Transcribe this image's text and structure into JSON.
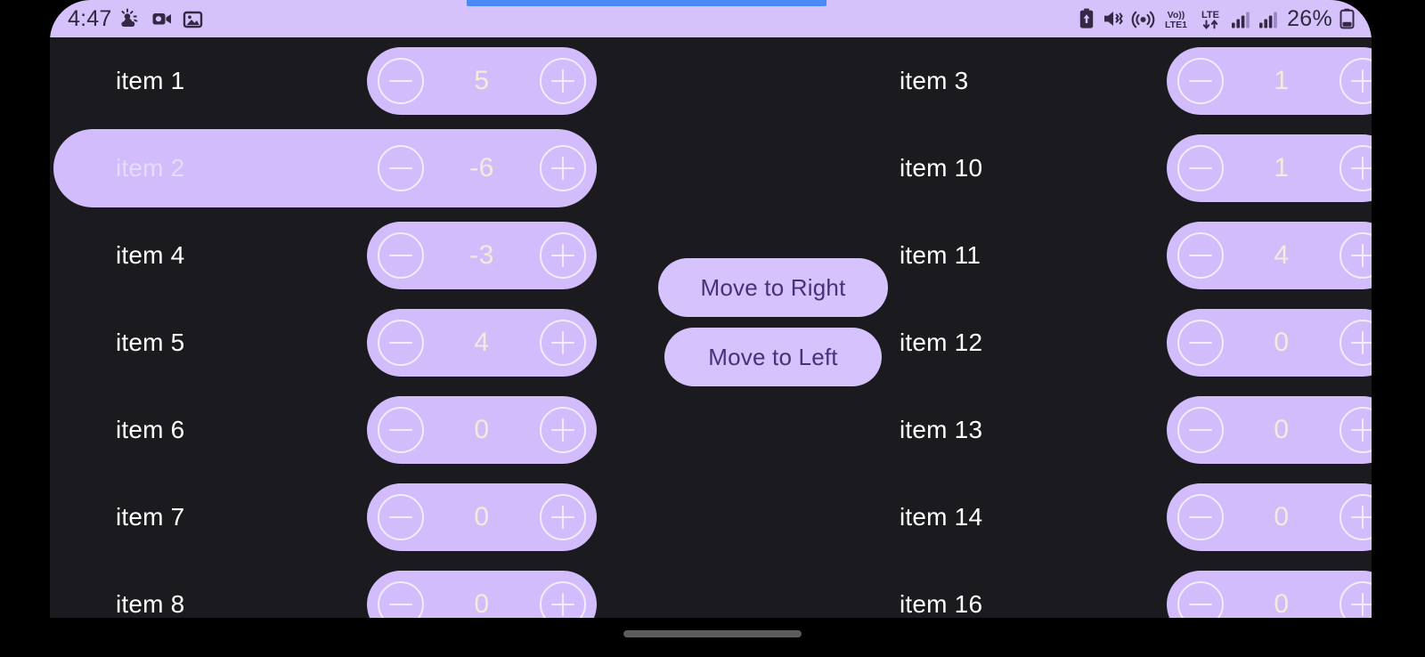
{
  "status_bar": {
    "clock": "4:47",
    "left_icons": [
      "weather-partly-cloudy-icon",
      "video-camera-icon",
      "image-gallery-icon"
    ],
    "right_icons": [
      "battery-saver-icon",
      "vibrate-mute-icon",
      "hotspot-icon",
      "volte-lte1-icon",
      "lte-data-icon",
      "signal-bars-sim1-icon",
      "signal-bars-sim2-icon"
    ],
    "battery_text": "26%",
    "battery_icon": "battery-icon",
    "background": "#d5c2fb"
  },
  "indicator": {
    "name": "top-progress-indicator",
    "color": "#4a8af4"
  },
  "theme": {
    "app_background": "#1b1b1f",
    "accent_purple": "#d2bcfb",
    "button_text": "#4a2f7a",
    "value_text": "#f2ecd8",
    "label_text": "#ffffff"
  },
  "stepper_icons": {
    "decrement": "minus-circle-icon",
    "increment": "plus-circle-icon"
  },
  "left_column": [
    {
      "label": "item 1",
      "value": "5",
      "selected": false
    },
    {
      "label": "item 2",
      "value": "-6",
      "selected": true
    },
    {
      "label": "item 4",
      "value": "-3",
      "selected": false
    },
    {
      "label": "item 5",
      "value": "4",
      "selected": false
    },
    {
      "label": "item 6",
      "value": "0",
      "selected": false
    },
    {
      "label": "item 7",
      "value": "0",
      "selected": false
    },
    {
      "label": "item 8",
      "value": "0",
      "selected": false
    }
  ],
  "right_column": [
    {
      "label": "item 3",
      "value": "1",
      "selected": false
    },
    {
      "label": "item 10",
      "value": "1",
      "selected": false
    },
    {
      "label": "item 11",
      "value": "4",
      "selected": false
    },
    {
      "label": "item 12",
      "value": "0",
      "selected": false
    },
    {
      "label": "item 13",
      "value": "0",
      "selected": false
    },
    {
      "label": "item 14",
      "value": "0",
      "selected": false
    },
    {
      "label": "item 16",
      "value": "0",
      "selected": false
    }
  ],
  "center_buttons": {
    "move_right": "Move to Right",
    "move_left": "Move to Left"
  },
  "navigation": {
    "gesture_bar": "home-gesture-bar"
  }
}
